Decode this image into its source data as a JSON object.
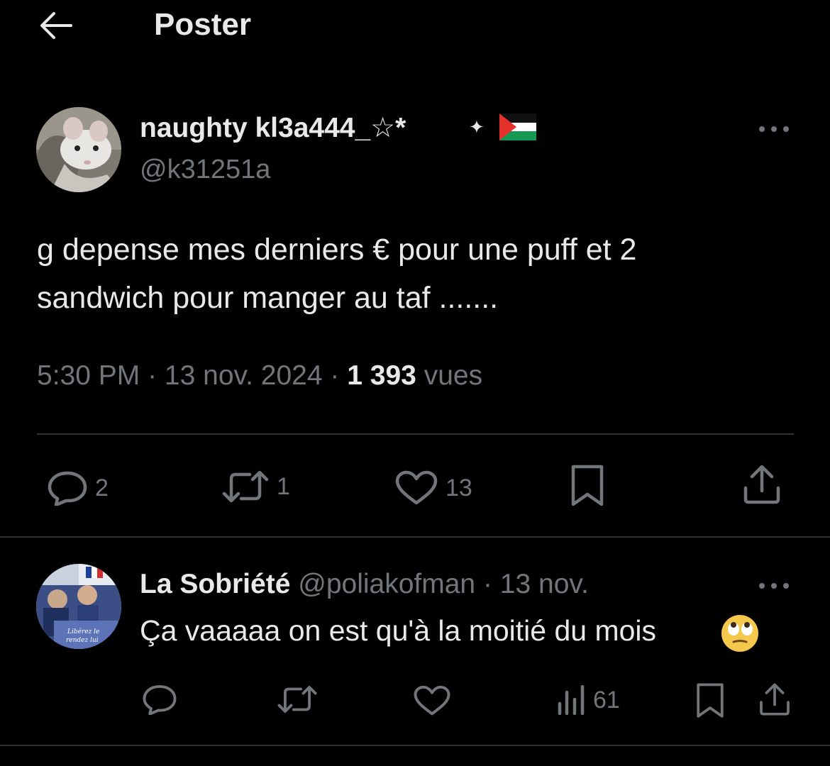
{
  "header": {
    "title": "Poster"
  },
  "tweet": {
    "author_name": "naughty kl3a444_☆*",
    "author_handle": "@k31251a",
    "text": "g depense mes derniers € pour une puff et 2\nsandwich pour manger au taf  .......",
    "time": "5:30 PM",
    "date": "13 nov. 2024",
    "views": "1 393",
    "views_label": "vues",
    "actions": {
      "replies": "2",
      "reposts": "1",
      "likes": "13"
    }
  },
  "reply": {
    "author_name": "La Sobriété",
    "author_handle": "@poliakofman",
    "date": "13 nov.",
    "text": "Ça vaaaaa on est qu'à la moitié du mois",
    "emoji": "face-with-rolling-eyes",
    "actions": {
      "views": "61"
    }
  },
  "colors": {
    "background": "#000000",
    "text": "#e7e9ea",
    "muted": "#71767b",
    "divider": "#2f3336"
  }
}
